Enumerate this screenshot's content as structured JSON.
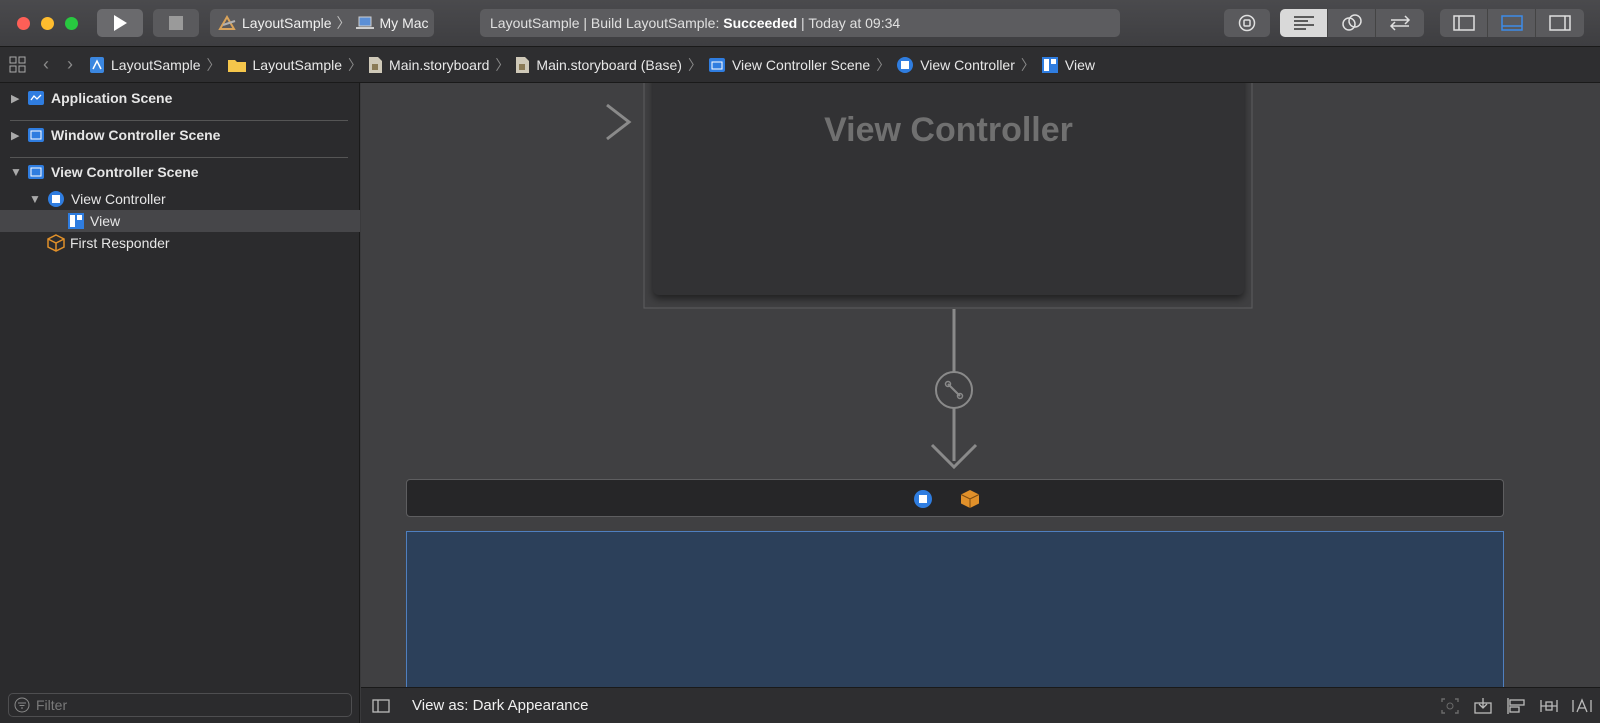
{
  "toolbar": {
    "scheme_name": "LayoutSample",
    "destination": "My Mac",
    "activity_prefix": "LayoutSample | Build LayoutSample: ",
    "activity_status": "Succeeded",
    "activity_suffix": " | Today at 09:34"
  },
  "jumpbar": {
    "crumbs": [
      "LayoutSample",
      "LayoutSample",
      "Main.storyboard",
      "Main.storyboard (Base)",
      "View Controller Scene",
      "View Controller",
      "View"
    ]
  },
  "outline": {
    "items": [
      {
        "label": "Application Scene"
      },
      {
        "label": "Window Controller Scene"
      },
      {
        "label": "View Controller Scene"
      },
      {
        "label": "View Controller"
      },
      {
        "label": "View"
      },
      {
        "label": "First Responder"
      }
    ],
    "filter_placeholder": "Filter"
  },
  "canvas": {
    "scene_title": "View Controller"
  },
  "bottombar": {
    "view_as": "View as: Dark Appearance"
  },
  "colors": {
    "accent": "#2f7de0",
    "responder": "#e0902a",
    "selected_view": "#2c405a"
  }
}
